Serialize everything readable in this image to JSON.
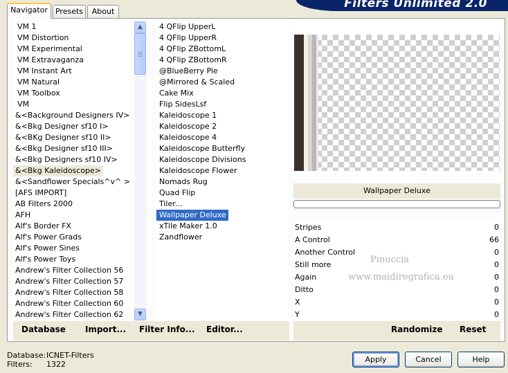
{
  "app": {
    "title": "Filters Unlimited 2.0"
  },
  "tabs": [
    {
      "label": "Navigator",
      "active": true
    },
    {
      "label": "Presets",
      "active": false
    },
    {
      "label": "About",
      "active": false
    }
  ],
  "categories": [
    "VM 1",
    "VM Distortion",
    "VM Experimental",
    "VM Extravaganza",
    "VM Instant Art",
    "VM Natural",
    "VM Toolbox",
    "VM",
    "&<Background Designers IV>",
    "&<Bkg Designer sf10 I>",
    "&<BKg Designer sf10 II>",
    "&<Bkg Designer sf10 III>",
    "&<Bkg Designers sf10 IV>",
    "&<Bkg Kaleidoscope>",
    "&<Sandflower Specials^v^ >",
    "[AFS IMPORT]",
    "AB Filters 2000",
    "AFH",
    "Alf's Border FX",
    "Alf's Power Grads",
    "Alf's Power Sines",
    "Alf's Power Toys",
    "Andrew's Filter Collection 56",
    "Andrew's Filter Collection 57",
    "Andrew's Filter Collection 58",
    "Andrew's Filter Collection 60",
    "Andrew's Filter Collection 62"
  ],
  "selected_category": "&<Bkg Kaleidoscope>",
  "filters": [
    "4 QFlip UpperL",
    "4 QFlip UpperR",
    "4 QFlip ZBottomL",
    "4 QFlip ZBottomR",
    "@BlueBerry Pie",
    "@Mirrored & Scaled",
    "Cake Mix",
    "Flip SidesLsf",
    "Kaleidoscope 1",
    "Kaleidoscope 2",
    "Kaleidoscope 4",
    "Kaleidoscope Butterfly",
    "Kaleidoscope Divisions",
    "Kaleidoscope Flower",
    "Nomads Rug",
    "Quad Flip",
    "Tiler...",
    "Wallpaper Deluxe",
    "xTile Maker 1.0",
    "Zandflower"
  ],
  "selected_filter": "Wallpaper Deluxe",
  "preview": {
    "filter_name": "Wallpaper Deluxe"
  },
  "watermark": {
    "line1": "Pinuccia",
    "line2": "www.maidiregrafica.eu"
  },
  "params": [
    {
      "label": "Stripes",
      "value": "0"
    },
    {
      "label": "A Control",
      "value": "66"
    },
    {
      "label": "Another Control",
      "value": "0"
    },
    {
      "label": "Still more",
      "value": "0"
    },
    {
      "label": "Again",
      "value": "0"
    },
    {
      "label": "Ditto",
      "value": "0"
    },
    {
      "label": "X",
      "value": "0"
    },
    {
      "label": "Y",
      "value": "0"
    }
  ],
  "toolbar": {
    "database": "Database",
    "import": "Import...",
    "filter_info": "Filter Info...",
    "editor": "Editor...",
    "randomize": "Randomize",
    "reset": "Reset"
  },
  "status": {
    "database_label": "Database:",
    "database_value": "ICNET-Filters",
    "filters_label": "Filters:",
    "filters_value": "1322"
  },
  "buttons": {
    "apply": "Apply",
    "cancel": "Cancel",
    "help": "Help"
  },
  "colors": {
    "selection": "#316ac5",
    "banner": "#0a246a",
    "dialog_bg": "#ece9d8"
  }
}
